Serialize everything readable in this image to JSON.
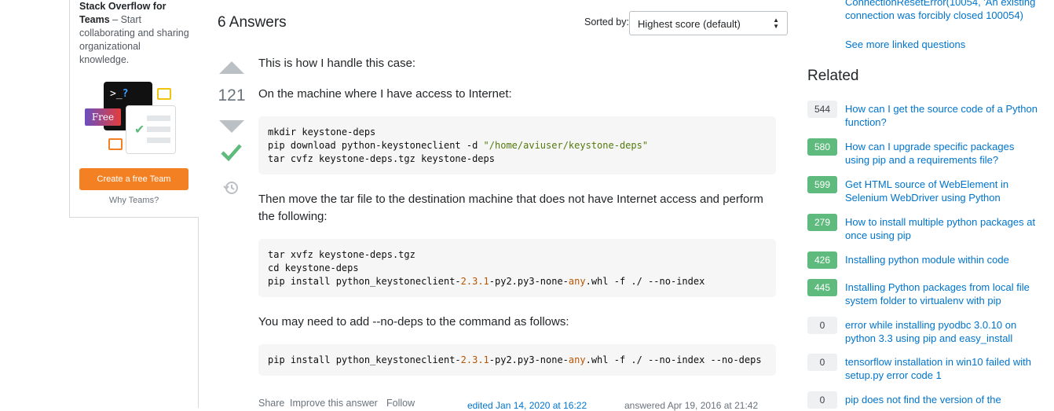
{
  "teams": {
    "title": "Stack Overflow for Teams",
    "dash": " – ",
    "blurb": "Start collaborating and sharing organizational knowledge.",
    "badge": "Free",
    "prompt": ">_",
    "prompt_q": "?",
    "cta": "Create a free Team",
    "why": "Why Teams?"
  },
  "answers": {
    "title": "6 Answers",
    "sorted_label": "Sorted by:",
    "sort_value": "Highest score (default)"
  },
  "answer": {
    "votes": "121",
    "p1": "This is how I handle this case:",
    "p2": "On the machine where I have access to Internet:",
    "code1": [
      "mkdir keystone-deps",
      "pip download python-keystoneclient -d ",
      "\"/home/aviuser/keystone-deps\"",
      "tar cvfz keystone-deps.tgz keystone-deps"
    ],
    "p3": "Then move the tar file to the destination machine that does not have Internet access and perform the following:",
    "code2": {
      "line1": "tar xvfz keystone-deps.tgz",
      "line2": "cd keystone-deps",
      "line3_a": "pip install python_keystoneclient-",
      "line3_ver": "2.3.1",
      "line3_b": "-py2.py3-none-",
      "line3_any": "any",
      "line3_c": ".whl -f ./ --no-index"
    },
    "p4": "You may need to add --no-deps to the command as follows:",
    "code3": {
      "a": "pip install python_keystoneclient-",
      "ver": "2.3.1",
      "b": "-py2.py3-none-",
      "any": "any",
      "c": ".whl -f ./ --no-index --no-deps"
    },
    "share": "Share",
    "improve": "Improve this answer",
    "follow": "Follow",
    "edited": "edited Jan 14, 2020 at 16:22",
    "answered": "answered Apr 19, 2016 at 21:42"
  },
  "linked": {
    "partial_1": "ConnectionResetError(10054, 'An existing",
    "partial_2": "connection was forcibly closed 100054)",
    "see_more": "See more linked questions"
  },
  "related": {
    "title": "Related",
    "items": [
      {
        "score": "544",
        "title": "How can I get the source code of a Python function?",
        "accepted": false
      },
      {
        "score": "580",
        "title": "How can I upgrade specific packages using pip and a requirements file?",
        "accepted": true
      },
      {
        "score": "599",
        "title": "Get HTML source of WebElement in Selenium WebDriver using Python",
        "accepted": true
      },
      {
        "score": "279",
        "title": "How to install multiple python packages at once using pip",
        "accepted": true
      },
      {
        "score": "426",
        "title": "Installing python module within code",
        "accepted": true
      },
      {
        "score": "445",
        "title": "Installing Python packages from local file system folder to virtualenv with pip",
        "accepted": true
      },
      {
        "score": "0",
        "title": "error while installing pyodbc 3.0.10 on python 3.3 using pip and easy_install",
        "accepted": false
      },
      {
        "score": "0",
        "title": "tensorflow installation in win10 failed with setup.py error code 1",
        "accepted": false
      },
      {
        "score": "0",
        "title": "pip does not find the version of the",
        "accepted": false
      }
    ]
  },
  "colors": {
    "accent": "#f48024",
    "link": "#0074cc",
    "accepted_green": "#5eba7d"
  }
}
